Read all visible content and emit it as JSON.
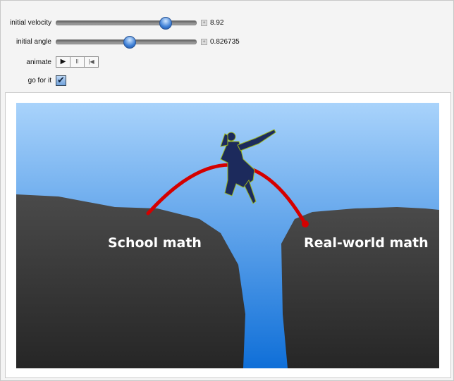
{
  "controls": {
    "velocity": {
      "label": "initial velocity",
      "value": "8.92",
      "fraction": 0.78
    },
    "angle": {
      "label": "initial angle",
      "value": "0.826735",
      "fraction": 0.52
    },
    "animate": {
      "label": "animate",
      "buttons": [
        "▶",
        "II",
        "|◀"
      ]
    },
    "go": {
      "label": "go for it",
      "checked": true
    }
  },
  "scene": {
    "left_label": "School math",
    "right_label": "Real-world math",
    "trajectory_color": "#d40000"
  }
}
